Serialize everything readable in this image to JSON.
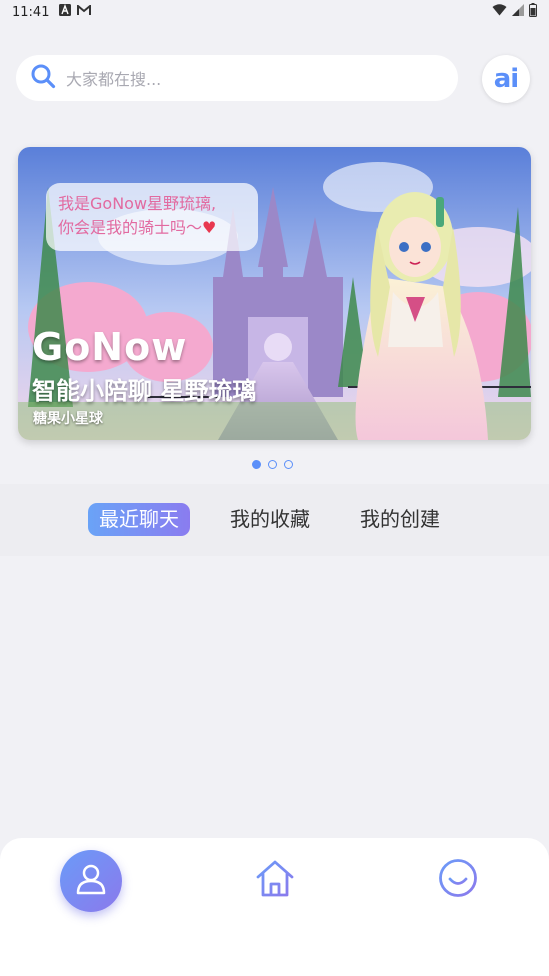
{
  "status_bar": {
    "time": "11:41",
    "left_icons": [
      "font-icon",
      "gmail-icon"
    ],
    "right_icons": [
      "wifi-icon",
      "signal-icon",
      "battery-icon"
    ]
  },
  "search": {
    "placeholder": "大家都在搜..."
  },
  "ai_button": {
    "label": "ai"
  },
  "banner": {
    "bubble_line1": "我是GoNow星野琉璃,",
    "bubble_line2": "你会是我的骑士吗〜",
    "bubble_heart": "♥",
    "brand": "GoNow",
    "subtitle": "智能小陪聊 星野琉璃",
    "tag": "糖果小星球",
    "pages": 3,
    "active_page": 1
  },
  "tabs": [
    {
      "label": "最近聊天",
      "active": true
    },
    {
      "label": "我的收藏",
      "active": false
    },
    {
      "label": "我的创建",
      "active": false
    }
  ],
  "bottom_nav": {
    "items": [
      {
        "icon": "profile-icon",
        "active": true
      },
      {
        "icon": "home-icon",
        "active": false
      },
      {
        "icon": "smile-icon",
        "active": false
      }
    ]
  },
  "colors": {
    "accent": "#5b8ff9",
    "accent_gradient_end": "#8a7cf0",
    "background": "#f1f1f5"
  }
}
